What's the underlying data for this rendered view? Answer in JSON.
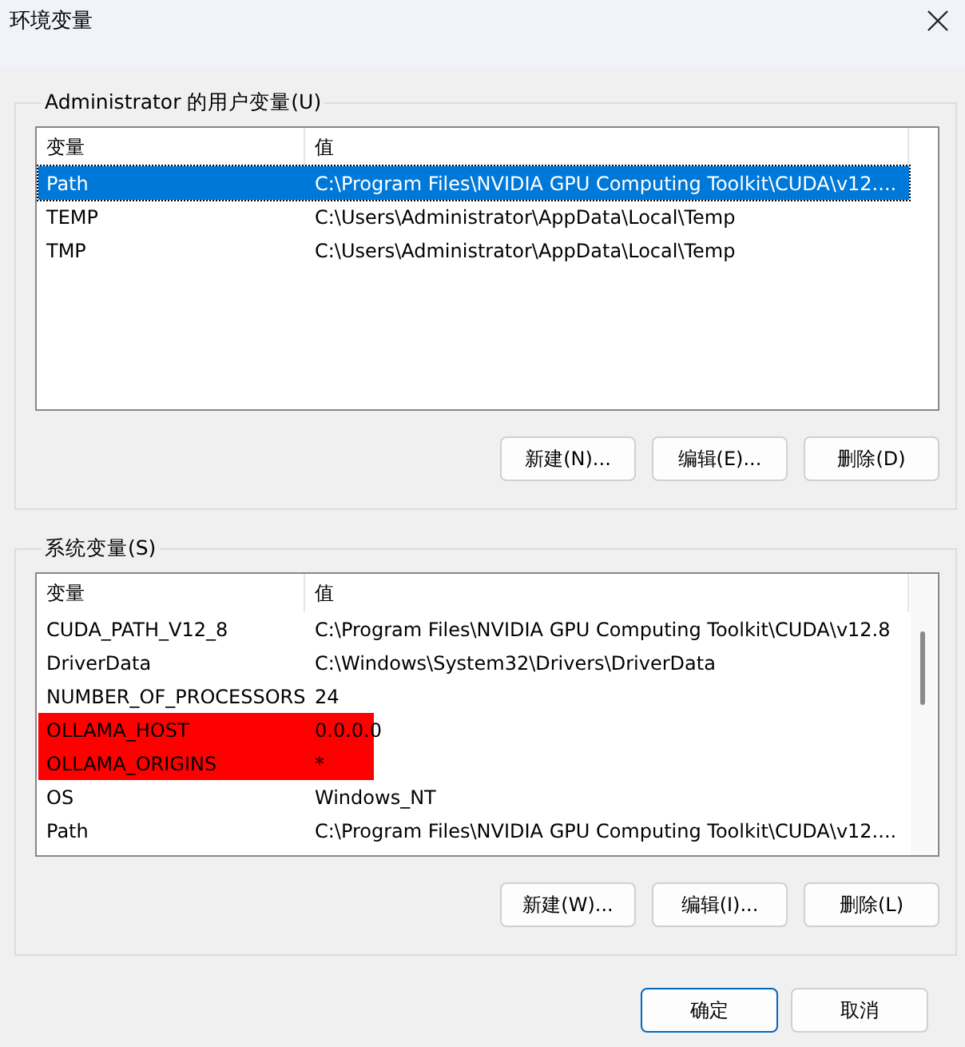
{
  "window": {
    "title": "环境变量"
  },
  "user_variables": {
    "title": "Administrator 的用户变量(U)",
    "columns": [
      "变量",
      "值"
    ],
    "rows": [
      {
        "name": "Path",
        "value": "C:\\Program Files\\NVIDIA GPU Computing Toolkit\\CUDA\\v12....",
        "selected": true,
        "redacted": false
      },
      {
        "name": "TEMP",
        "value": "C:\\Users\\Administrator\\AppData\\Local\\Temp",
        "selected": false,
        "redacted": false
      },
      {
        "name": "TMP",
        "value": "C:\\Users\\Administrator\\AppData\\Local\\Temp",
        "selected": false,
        "redacted": false
      }
    ],
    "buttons": [
      "新建(N)...",
      "编辑(E)...",
      "删除(D)"
    ]
  },
  "system_variables": {
    "title": "系统变量(S)",
    "columns": [
      "变量",
      "值"
    ],
    "rows": [
      {
        "name": "CUDA_PATH_V12_8",
        "value": "C:\\Program Files\\NVIDIA GPU Computing Toolkit\\CUDA\\v12.8",
        "selected": false,
        "redacted": false
      },
      {
        "name": "DriverData",
        "value": "C:\\Windows\\System32\\Drivers\\DriverData",
        "selected": false,
        "redacted": false
      },
      {
        "name": "NUMBER_OF_PROCESSORS",
        "value": "24",
        "selected": false,
        "redacted": false
      },
      {
        "name": "OLLAMA_HOST",
        "value": "0.0.0.0",
        "selected": false,
        "redacted": true
      },
      {
        "name": "OLLAMA_ORIGINS",
        "value": "*",
        "selected": false,
        "redacted": true
      },
      {
        "name": "OS",
        "value": "Windows_NT",
        "selected": false,
        "redacted": false
      },
      {
        "name": "Path",
        "value": "C:\\Program Files\\NVIDIA GPU Computing Toolkit\\CUDA\\v12....",
        "selected": false,
        "redacted": false
      }
    ],
    "buttons": [
      "新建(W)...",
      "编辑(I)...",
      "删除(L)"
    ]
  },
  "dialog_buttons": [
    {
      "label": "确定",
      "default": true
    },
    {
      "label": "取消",
      "default": false
    }
  ]
}
